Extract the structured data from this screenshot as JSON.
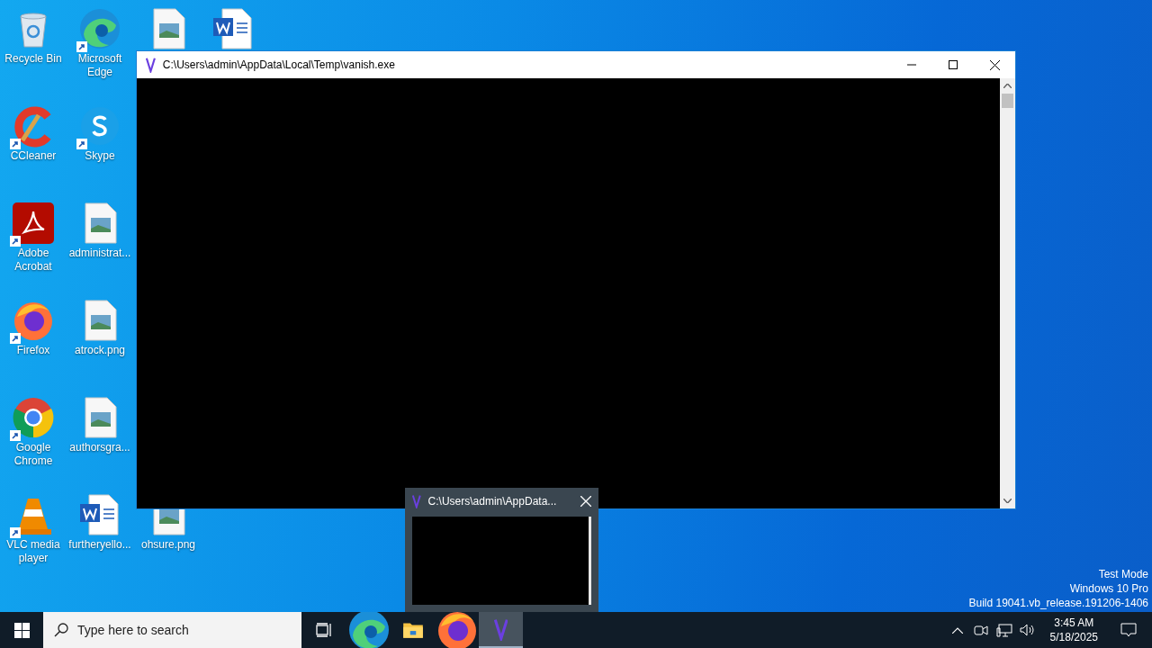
{
  "desktop_icons": [
    {
      "kind": "recycle",
      "label": "Recycle Bin",
      "shortcut": false
    },
    {
      "kind": "ccleaner",
      "label": "CCleaner",
      "shortcut": true
    },
    {
      "kind": "acrobat",
      "label": "Adobe Acrobat",
      "shortcut": true
    },
    {
      "kind": "firefox",
      "label": "Firefox",
      "shortcut": true
    },
    {
      "kind": "chrome",
      "label": "Google Chrome",
      "shortcut": true
    },
    {
      "kind": "vlc",
      "label": "VLC media player",
      "shortcut": true
    },
    {
      "kind": "edge",
      "label": "Microsoft Edge",
      "shortcut": true
    },
    {
      "kind": "skype",
      "label": "Skype",
      "shortcut": true
    },
    {
      "kind": "image",
      "label": "administrat...",
      "shortcut": false
    },
    {
      "kind": "image",
      "label": "atrock.png",
      "shortcut": false
    },
    {
      "kind": "image",
      "label": "authorsgra...",
      "shortcut": false
    },
    {
      "kind": "word",
      "label": "furtheryello...",
      "shortcut": false
    },
    {
      "kind": "image",
      "shortcut": false
    },
    {
      "kind": "image",
      "label": "ohsure.png",
      "shortcut": false
    },
    {
      "kind": "word",
      "shortcut": false
    }
  ],
  "console_window": {
    "title": "C:\\Users\\admin\\AppData\\Local\\Temp\\vanish.exe"
  },
  "thumbnail_preview": {
    "title": "C:\\Users\\admin\\AppData..."
  },
  "system_notice": [
    "Test Mode",
    "Windows 10 Pro",
    "Build 19041.vb_release.191206-1406"
  ],
  "taskbar": {
    "search": {
      "placeholder": "Type here to search"
    },
    "apps": [
      {
        "kind": "edge",
        "selected": false
      },
      {
        "kind": "explorer",
        "selected": false
      },
      {
        "kind": "firefox",
        "selected": false
      },
      {
        "kind": "vanish",
        "selected": true
      }
    ],
    "clock": {
      "time": "3:45 AM",
      "date": "5/18/2025"
    }
  }
}
